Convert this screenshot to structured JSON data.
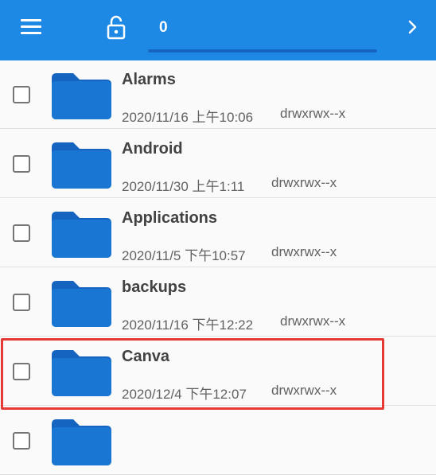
{
  "toolbar": {
    "menu_icon": "menu-icon",
    "lock_icon": "lock-open-icon",
    "path_value": "0",
    "next_icon": "chevron-right-icon",
    "color": "#1e88e5"
  },
  "files": [
    {
      "name": "Alarms",
      "date": "2020/11/16 上午10:06",
      "perm": "drwxrwx--x"
    },
    {
      "name": "Android",
      "date": "2020/11/30 上午1:11",
      "perm": "drwxrwx--x"
    },
    {
      "name": "Applications",
      "date": "2020/11/5 下午10:57",
      "perm": "drwxrwx--x"
    },
    {
      "name": "backups",
      "date": "2020/11/16 下午12:22",
      "perm": "drwxrwx--x"
    },
    {
      "name": "Canva",
      "date": "2020/12/4 下午12:07",
      "perm": "drwxrwx--x"
    }
  ],
  "highlight_color": "#e53935"
}
